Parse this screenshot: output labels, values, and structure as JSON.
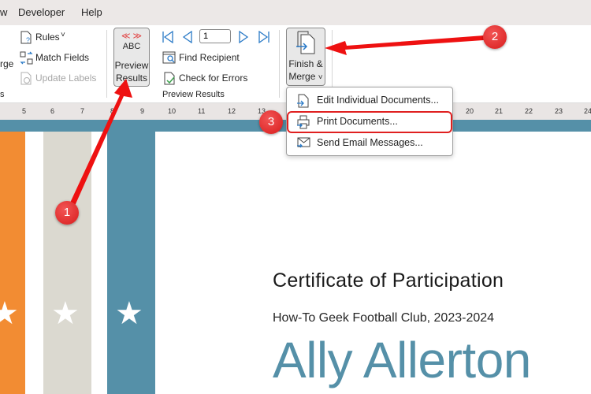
{
  "menubar": {
    "items": [
      "w",
      "Developer",
      "Help"
    ]
  },
  "ribbon": {
    "write_insert": {
      "partial_label": "rge",
      "group_label_partial": "s",
      "rules": "Rules",
      "match_fields": "Match Fields",
      "update_labels": "Update Labels"
    },
    "preview": {
      "abc": "ABC",
      "preview_results_line1": "Preview",
      "preview_results_line2": "Results",
      "record_value": "1",
      "find_recipient": "Find Recipient",
      "check_errors": "Check for Errors",
      "group_label": "Preview Results"
    },
    "finish": {
      "line1": "Finish &",
      "line2": "Merge",
      "chevron": "˅"
    }
  },
  "ruler": {
    "ticks": [
      "5",
      "6",
      "7",
      "8",
      "9",
      "10",
      "11",
      "12",
      "13",
      "20",
      "21",
      "22",
      "23",
      "24"
    ]
  },
  "dropdown": {
    "items": [
      {
        "label": "Edit Individual Documents...",
        "icon": "edit-documents-icon",
        "accesskey": "E"
      },
      {
        "label": "Print Documents...",
        "icon": "print-icon",
        "accesskey": "P"
      },
      {
        "label": "Send Email Messages...",
        "icon": "email-icon",
        "accesskey": "S"
      }
    ]
  },
  "document": {
    "title": "Certificate of Participation",
    "subtitle": "How-To Geek Football Club, 2023-2024",
    "recipient_name": "Ally Allerton",
    "stripe_colors": [
      "#f28c33",
      "#dbd9d0",
      "#5590a8"
    ],
    "star": "★"
  },
  "annotations": {
    "badges": [
      "1",
      "2",
      "3"
    ],
    "color": "#e02020"
  }
}
